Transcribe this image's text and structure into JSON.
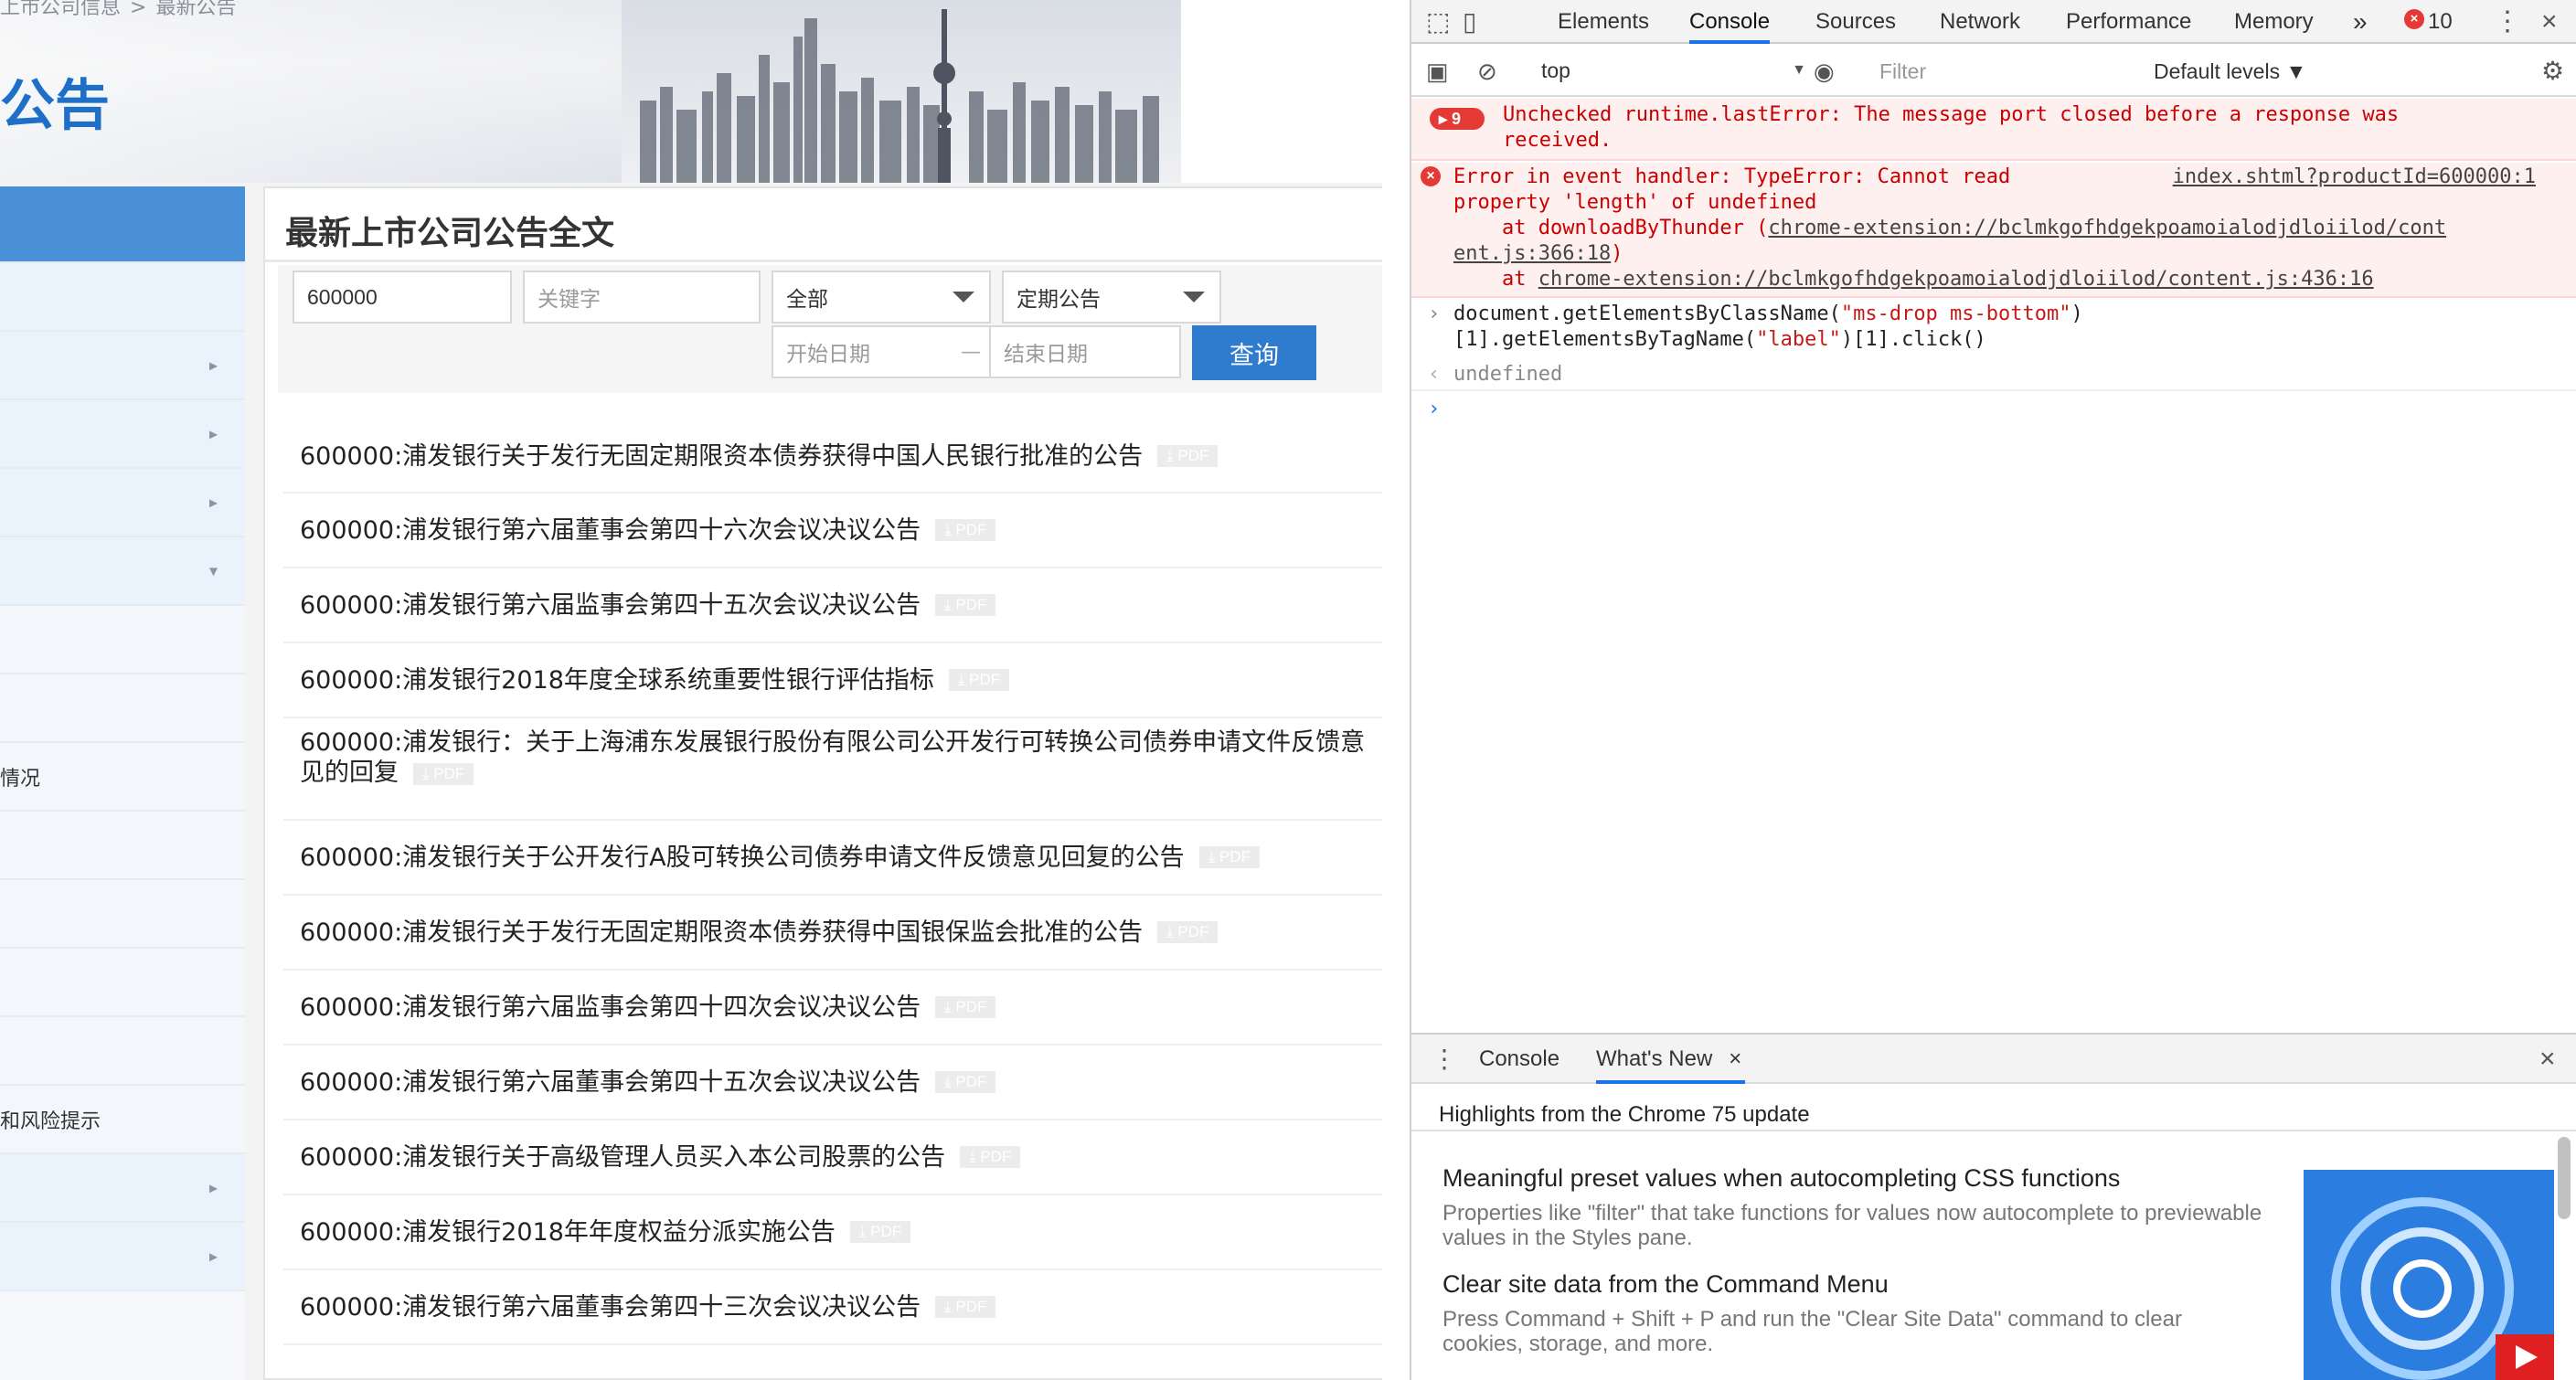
{
  "webpage": {
    "breadcrumb": [
      "上市公司信息",
      "最新公告"
    ],
    "banner_title": "公告",
    "sidebar": {
      "items": [
        {
          "label": "",
          "active": true,
          "arrow": ""
        },
        {
          "label": "",
          "arrow": ""
        },
        {
          "label": "",
          "arrow": "▸"
        },
        {
          "label": "",
          "arrow": "▸"
        },
        {
          "label": "",
          "arrow": "▸"
        },
        {
          "label": "",
          "arrow": "▾"
        },
        {
          "label": "",
          "arrow": ""
        },
        {
          "label": "",
          "arrow": ""
        },
        {
          "label": "情况",
          "arrow": ""
        },
        {
          "label": "",
          "arrow": ""
        },
        {
          "label": "",
          "arrow": ""
        },
        {
          "label": "",
          "arrow": ""
        },
        {
          "label": "",
          "arrow": ""
        },
        {
          "label": "和风险提示",
          "arrow": ""
        },
        {
          "label": "",
          "arrow": "▸"
        },
        {
          "label": "",
          "arrow": "▸"
        }
      ]
    },
    "content_title": "最新上市公司公告全文",
    "filters": {
      "stock_code": "600000",
      "keyword_placeholder": "关键字",
      "category": "全部",
      "type": "定期公告",
      "start_date_placeholder": "开始日期",
      "date_separator": "—",
      "end_date_placeholder": "结束日期",
      "search_label": "查询"
    },
    "pdf_label": "PDF",
    "announcements": [
      "600000:浦发银行关于发行无固定期限资本债券获得中国人民银行批准的公告",
      "600000:浦发银行第六届董事会第四十六次会议决议公告",
      "600000:浦发银行第六届监事会第四十五次会议决议公告",
      "600000:浦发银行2018年度全球系统重要性银行评估指标",
      "600000:浦发银行：关于上海浦东发展银行股份有限公司公开发行可转换公司债券申请文件反馈意见的回复",
      "600000:浦发银行关于公开发行A股可转换公司债券申请文件反馈意见回复的公告",
      "600000:浦发银行关于发行无固定期限资本债券获得中国银保监会批准的公告",
      "600000:浦发银行第六届监事会第四十四次会议决议公告",
      "600000:浦发银行第六届董事会第四十五次会议决议公告",
      "600000:浦发银行关于高级管理人员买入本公司股票的公告",
      "600000:浦发银行2018年年度权益分派实施公告",
      "600000:浦发银行第六届董事会第四十三次会议决议公告"
    ]
  },
  "devtools": {
    "tabs": [
      "Elements",
      "Console",
      "Sources",
      "Network",
      "Performance",
      "Memory"
    ],
    "active_tab": "Console",
    "more_tabs": "»",
    "error_count": "10",
    "context": "top",
    "filter_placeholder": "Filter",
    "levels": "Default levels ▼",
    "messages": {
      "m1_count": "9",
      "m1_text": "Unchecked runtime.lastError: The message port closed before a response was\nreceived.",
      "m2_line1": "Error in event handler: TypeError: Cannot read",
      "m2_source": "index.shtml?productId=600000:1",
      "m2_line2": "property 'length' of undefined",
      "m2_line3": "    at downloadByThunder (",
      "m2_link1": "chrome-extension://bclmkgofhdgekpoamoialodjdloiilod/cont",
      "m2_link1b": "ent.js:366:18",
      "m2_line3end": ")",
      "m2_line4": "    at ",
      "m2_link2": "chrome-extension://bclmkgofhdgekpoamoialodjdloiilod/content.js:436:16",
      "cmd_part1": "document.getElementsByClassName(",
      "cmd_str1": "\"ms-drop ms-bottom\"",
      "cmd_part2": ")",
      "cmd_part3": "[1].getElementsByTagName(",
      "cmd_str2": "\"label\"",
      "cmd_part4": ")[1].click()",
      "result": "undefined"
    },
    "drawer": {
      "tabs": [
        "Console",
        "What's New"
      ],
      "active": "What's New",
      "highlights": "Highlights from the Chrome 75 update",
      "items": [
        {
          "title": "Meaningful preset values when autocompleting CSS functions",
          "desc": "Properties like \"filter\" that take functions for values now autocomplete to previewable values in the Styles pane."
        },
        {
          "title": "Clear site data from the Command Menu",
          "desc": "Press Command + Shift + P and run the \"Clear Site Data\" command to clear cookies, storage, and more."
        }
      ]
    }
  },
  "colors": {
    "accent": "#1a73e8",
    "error": "#c80000",
    "page_blue": "#2f7ccf"
  }
}
